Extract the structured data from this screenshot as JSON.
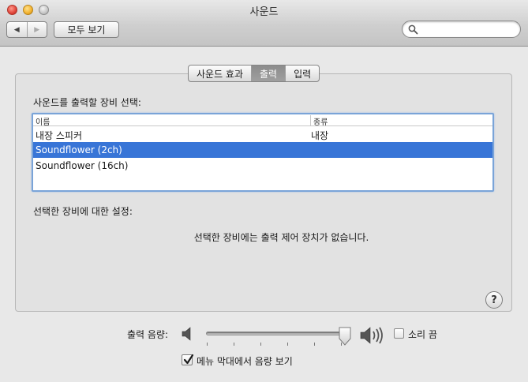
{
  "window": {
    "title": "사운드"
  },
  "toolbar": {
    "nav_back_label": "◀",
    "nav_forward_label": "▶",
    "show_all_label": "모두 보기",
    "search": {
      "placeholder": "",
      "value": ""
    }
  },
  "tabs": [
    {
      "label": "사운드 효과",
      "selected": false
    },
    {
      "label": "출력",
      "selected": true
    },
    {
      "label": "입력",
      "selected": false
    }
  ],
  "output": {
    "select_device_label": "사운드를 출력할 장비 선택:",
    "columns": {
      "name": "이름",
      "type": "종류"
    },
    "devices": [
      {
        "name": "내장 스피커",
        "type": "내장",
        "selected": false
      },
      {
        "name": "Soundflower (2ch)",
        "type": "",
        "selected": true
      },
      {
        "name": "Soundflower (16ch)",
        "type": "",
        "selected": false
      }
    ],
    "settings_label": "선택한 장비에 대한 설정:",
    "no_controls_message": "선택한 장비에는 출력 제어 장치가 없습니다."
  },
  "help": {
    "label": "?"
  },
  "volume": {
    "label": "출력 음량:",
    "level": 0.98,
    "mute_label": "소리 끔",
    "mute_checked": false,
    "show_in_menu_label": "메뉴 막대에서 음량 보기",
    "show_in_menu_checked": true
  },
  "colors": {
    "selection": "#3875d7",
    "list_focus_ring": "#7aa4d8",
    "selected_tab": "#8c8c8c"
  }
}
